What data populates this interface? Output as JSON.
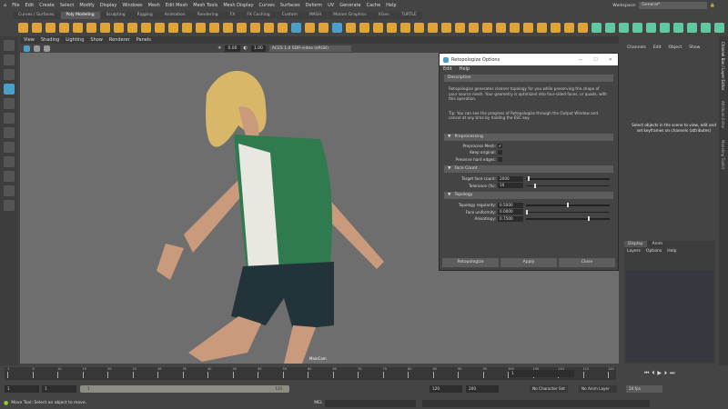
{
  "menu": [
    "File",
    "Edit",
    "Create",
    "Select",
    "Modify",
    "Display",
    "Windows",
    "Mesh",
    "Edit Mesh",
    "Mesh Tools",
    "Mesh Display",
    "Curves",
    "Surfaces",
    "Deform",
    "UV",
    "Generate",
    "Cache",
    "Help"
  ],
  "workspace": {
    "label": "Workspace:",
    "value": "General*"
  },
  "shelf_tabs": [
    "Curves / Surfaces",
    "Poly Modeling",
    "Sculpting",
    "Rigging",
    "Animation",
    "Rendering",
    "FX",
    "FX Caching",
    "Custom",
    "MASH",
    "Motion Graphics",
    "XGen",
    "TURTLE"
  ],
  "shelf_active": "Poly Modeling",
  "viewport": {
    "menu": [
      "View",
      "Shading",
      "Lighting",
      "Show",
      "Renderer",
      "Panels"
    ],
    "exposure": "0.00",
    "gamma": "1.00",
    "color_space": "ACES 1.0 SDR-video (sRGB)",
    "camera": "MainCam"
  },
  "dialog": {
    "title": "Retopologize Options",
    "menu": [
      "Edit",
      "Help"
    ],
    "description_header": "Description",
    "description": "Retopologize generates cleaner topology for you while preserving the shape of your source mesh. Your geometry is optimized into four-sided faces, or quads, with this operation.",
    "tip": "Tip: You can see the progress of Retopologize through the Output Window and cancel at any time by holding the ESC key.",
    "preprocessing": {
      "header": "Preprocessing",
      "items": [
        {
          "label": "Preprocess Mesh:",
          "checked": true
        },
        {
          "label": "Keep original:",
          "checked": false
        },
        {
          "label": "Preserve hard edges:",
          "checked": false
        }
      ]
    },
    "face_count": {
      "header": "Face Count",
      "fields": [
        {
          "label": "Target face count:",
          "value": "2000",
          "slider": 0.02
        },
        {
          "label": "Tolerance (%):",
          "value": "10",
          "slider": 0.1
        }
      ]
    },
    "topology": {
      "header": "Topology",
      "fields": [
        {
          "label": "Topology regularity:",
          "value": "0.5000",
          "slider": 0.5
        },
        {
          "label": "Face uniformity:",
          "value": "0.0000",
          "slider": 0.0
        },
        {
          "label": "Anisotropy:",
          "value": "0.7500",
          "slider": 0.75
        }
      ]
    },
    "buttons": [
      "Retopologize",
      "Apply",
      "Close"
    ]
  },
  "channel_box": {
    "menu": [
      "Channels",
      "Edit",
      "Object",
      "Show"
    ],
    "message": "Select objects in the scene to view, edit and set keyframes on channels (attributes)"
  },
  "side_tabs": [
    "Channel Box / Layer Editor",
    "Attribute Editor",
    "Modeling Toolkit"
  ],
  "layer_editor": {
    "tabs": [
      "Display",
      "Anim"
    ],
    "menu": [
      "Layers",
      "Options",
      "Help"
    ]
  },
  "timeline": {
    "ticks": [
      "1",
      "5",
      "10",
      "15",
      "20",
      "25",
      "30",
      "35",
      "40",
      "45",
      "50",
      "55",
      "60",
      "65",
      "70",
      "75",
      "80",
      "85",
      "90",
      "95",
      "100",
      "105",
      "110",
      "115",
      "120"
    ],
    "current_frame": "1"
  },
  "range": {
    "start": "1",
    "playback_start": "1",
    "slider_start": "1",
    "slider_end": "120",
    "playback_end": "120",
    "end": "200",
    "character_set": "No Character Set",
    "anim_layer": "No Anim Layer",
    "fps": "24 fps"
  },
  "status": {
    "help": "Move Tool: Select an object to move.",
    "mel_label": "MEL"
  },
  "colors": {
    "accent": "#4aa0c8",
    "shelf_icon": "#e0a33a",
    "viewport_bg": "#6e6e6e"
  }
}
